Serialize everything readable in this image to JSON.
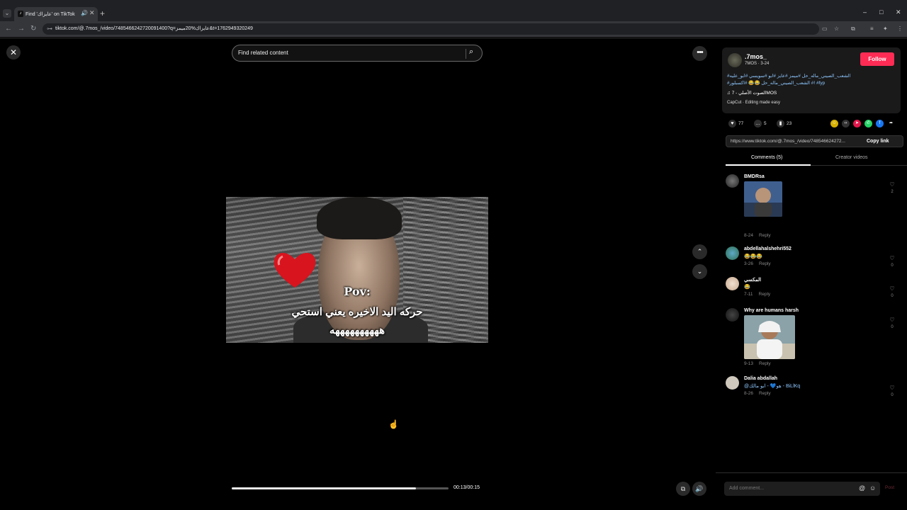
{
  "browser": {
    "tab_title": "Find 'عايزاك' on TikTok",
    "tab_favicon": "tiktok-icon",
    "url": "tiktok.com/@.7mos_/video/7485466242720091400?q=عايزاك%20ميمز&t=1762949320249",
    "new_tab_label": "+",
    "window_controls": [
      "–",
      "□",
      "✕"
    ]
  },
  "search": {
    "placeholder": "Find related content"
  },
  "video": {
    "pov_text": "Pov:",
    "caption_line1": "حركه اليد الاخيره يعني استحي",
    "caption_line2": "ههههههههههه",
    "progress": 0.85,
    "time": "00:13/00:15"
  },
  "author": {
    "username": ".7mos_",
    "subline": "7MOS · 3-24",
    "follow_label": "Follow",
    "description_line1": "#الشعب_الصيني_ماله_حل #ميمز #عايز #ابو #سويسي #ابو_عليه",
    "description_line2": "#الشعب_الصيني_ماله_حل 😂😂 #اكسبلور #! #fyp",
    "music": "♫ الصوت الأصلي - 7MOS",
    "capcut": "CapCut · Editing made easy"
  },
  "stats": {
    "likes": "77",
    "comments": "5",
    "saves": "23"
  },
  "share": {
    "link": "https://www.tiktok.com/@.7mos_/video/748546624272...",
    "copy_label": "Copy link"
  },
  "tabs": {
    "comments": "Comments (5)",
    "creator": "Creator videos"
  },
  "comments": [
    {
      "name": "BMDRsa",
      "text": "",
      "date": "8-24",
      "reply": "Reply",
      "likes": "2"
    },
    {
      "name": "abdellahalshehri552",
      "text": "😂😂😂",
      "date": "3-26",
      "reply": "Reply",
      "likes": "0"
    },
    {
      "name": "المكسي",
      "text": "😂",
      "date": "7-11",
      "reply": "Reply",
      "likes": "0"
    },
    {
      "name": "Why are humans harsh",
      "text": "",
      "date": "9-13",
      "reply": "Reply",
      "likes": "0"
    },
    {
      "name": "Dalia abdallah",
      "text": "@هو💙 - ابو مالك - BiLlKq",
      "date": "8-26",
      "reply": "Reply",
      "likes": "0"
    }
  ],
  "compose": {
    "placeholder": "Add comment...",
    "post_label": "Post"
  },
  "colors": {
    "accent": "#fe2c55",
    "link": "#8fc7ff",
    "panel_card": "#1a1a1a"
  }
}
